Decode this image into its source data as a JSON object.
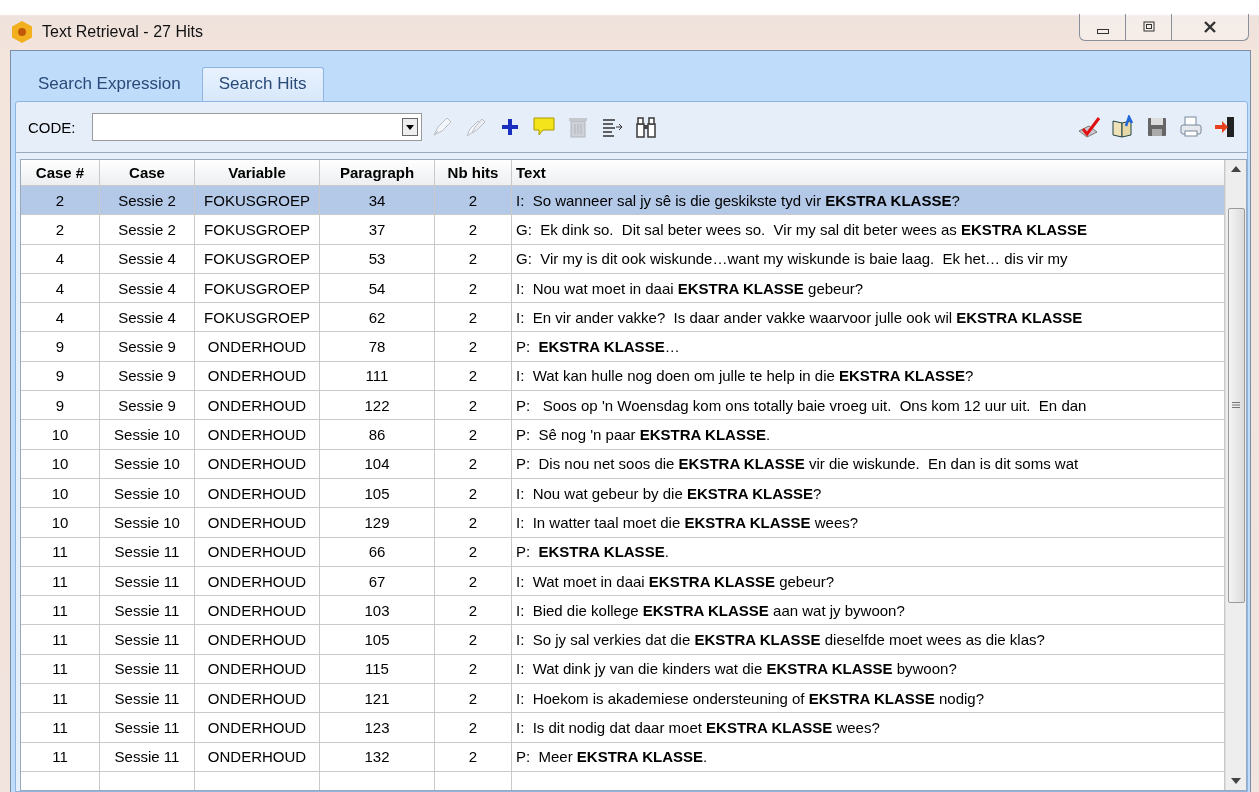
{
  "window": {
    "title": "Text Retrieval - 27 Hits"
  },
  "tabs": [
    {
      "label": "Search Expression",
      "selected": false
    },
    {
      "label": "Search Hits",
      "selected": true
    }
  ],
  "toolbar": {
    "code_label": "CODE:",
    "left": [
      {
        "kind": "pen",
        "disabled": true
      },
      {
        "kind": "pens",
        "disabled": true
      },
      {
        "kind": "plus",
        "disabled": false
      },
      {
        "kind": "comment",
        "disabled": false
      },
      {
        "kind": "trash",
        "disabled": true
      },
      {
        "kind": "lines",
        "disabled": false
      },
      {
        "kind": "binoculars",
        "disabled": false
      }
    ],
    "right": [
      {
        "kind": "check"
      },
      {
        "kind": "book"
      },
      {
        "kind": "save"
      },
      {
        "kind": "print"
      },
      {
        "kind": "exit"
      }
    ]
  },
  "table": {
    "columns": [
      "Case #",
      "Case",
      "Variable",
      "Paragraph",
      "Nb hits",
      "Text"
    ],
    "rows": [
      {
        "cells": [
          "2",
          "Sessie 2",
          "FOKUSGROEP",
          "34",
          "2",
          "I:  So wanneer sal jy sê is die geskikste tyd vir **EKSTRA KLASSE**?"
        ],
        "selected": true
      },
      {
        "cells": [
          "2",
          "Sessie 2",
          "FOKUSGROEP",
          "37",
          "2",
          "G:  Ek dink so.  Dit sal beter wees so.  Vir my sal dit beter wees as **EKSTRA KLASSE**"
        ],
        "selected": false
      },
      {
        "cells": [
          "4",
          "Sessie 4",
          "FOKUSGROEP",
          "53",
          "2",
          "G:  Vir my is dit ook wiskunde…want my wiskunde is baie laag.  Ek het… dis vir my"
        ],
        "selected": false
      },
      {
        "cells": [
          "4",
          "Sessie 4",
          "FOKUSGROEP",
          "54",
          "2",
          "I:  Nou wat moet in daai **EKSTRA KLASSE** gebeur?"
        ],
        "selected": false
      },
      {
        "cells": [
          "4",
          "Sessie 4",
          "FOKUSGROEP",
          "62",
          "2",
          "I:  En vir ander vakke?  Is daar ander vakke waarvoor julle ook wil **EKSTRA KLASSE**"
        ],
        "selected": false
      },
      {
        "cells": [
          "9",
          "Sessie 9",
          "ONDERHOUD",
          "78",
          "2",
          "P:  **EKSTRA KLASSE**…"
        ],
        "selected": false
      },
      {
        "cells": [
          "9",
          "Sessie 9",
          "ONDERHOUD",
          "111",
          "2",
          "I:  Wat kan hulle nog doen om julle te help in die **EKSTRA KLASSE**?"
        ],
        "selected": false
      },
      {
        "cells": [
          "9",
          "Sessie 9",
          "ONDERHOUD",
          "122",
          "2",
          "P:   Soos op 'n Woensdag kom ons totally baie vroeg uit.  Ons kom 12 uur uit.  En dan"
        ],
        "selected": false
      },
      {
        "cells": [
          "10",
          "Sessie 10",
          "ONDERHOUD",
          "86",
          "2",
          "P:  Sê nog 'n paar **EKSTRA KLASSE**."
        ],
        "selected": false
      },
      {
        "cells": [
          "10",
          "Sessie 10",
          "ONDERHOUD",
          "104",
          "2",
          "P:  Dis nou net soos die **EKSTRA KLASSE** vir die wiskunde.  En dan is dit soms wat"
        ],
        "selected": false
      },
      {
        "cells": [
          "10",
          "Sessie 10",
          "ONDERHOUD",
          "105",
          "2",
          "I:  Nou wat gebeur by die **EKSTRA KLASSE**?"
        ],
        "selected": false
      },
      {
        "cells": [
          "10",
          "Sessie 10",
          "ONDERHOUD",
          "129",
          "2",
          "I:  In watter taal moet die **EKSTRA KLASSE** wees?"
        ],
        "selected": false
      },
      {
        "cells": [
          "11",
          "Sessie 11",
          "ONDERHOUD",
          "66",
          "2",
          "P:  **EKSTRA KLASSE**."
        ],
        "selected": false
      },
      {
        "cells": [
          "11",
          "Sessie 11",
          "ONDERHOUD",
          "67",
          "2",
          "I:  Wat moet in daai **EKSTRA KLASSE** gebeur?"
        ],
        "selected": false
      },
      {
        "cells": [
          "11",
          "Sessie 11",
          "ONDERHOUD",
          "103",
          "2",
          "I:  Bied die kollege **EKSTRA KLASSE** aan wat jy bywoon?"
        ],
        "selected": false
      },
      {
        "cells": [
          "11",
          "Sessie 11",
          "ONDERHOUD",
          "105",
          "2",
          "I:  So jy sal verkies dat die **EKSTRA KLASSE** dieselfde moet wees as die klas?"
        ],
        "selected": false
      },
      {
        "cells": [
          "11",
          "Sessie 11",
          "ONDERHOUD",
          "115",
          "2",
          "I:  Wat dink jy van die kinders wat die **EKSTRA KLASSE** bywoon?"
        ],
        "selected": false
      },
      {
        "cells": [
          "11",
          "Sessie 11",
          "ONDERHOUD",
          "121",
          "2",
          "I:  Hoekom is akademiese ondersteuning of **EKSTRA KLASSE** nodig?"
        ],
        "selected": false
      },
      {
        "cells": [
          "11",
          "Sessie 11",
          "ONDERHOUD",
          "123",
          "2",
          "I:  Is dit nodig dat daar moet **EKSTRA KLASSE** wees?"
        ],
        "selected": false
      },
      {
        "cells": [
          "11",
          "Sessie 11",
          "ONDERHOUD",
          "132",
          "2",
          "P:  Meer **EKSTRA KLASSE**."
        ],
        "selected": false
      }
    ]
  }
}
